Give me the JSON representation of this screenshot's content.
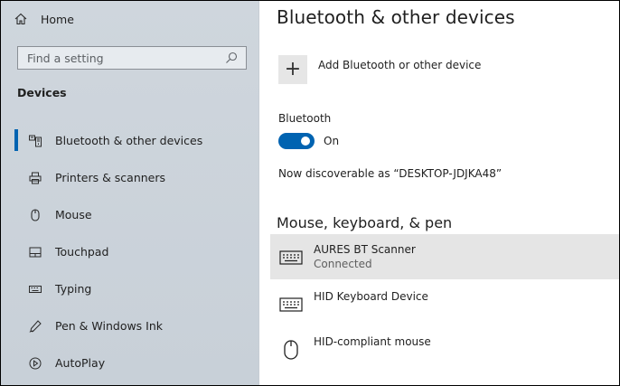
{
  "sidebar": {
    "home_label": "Home",
    "search_placeholder": "Find a setting",
    "section_title": "Devices",
    "items": [
      {
        "label": "Bluetooth & other devices",
        "icon": "bluetooth-devices-icon",
        "active": true
      },
      {
        "label": "Printers & scanners",
        "icon": "printer-icon"
      },
      {
        "label": "Mouse",
        "icon": "mouse-icon"
      },
      {
        "label": "Touchpad",
        "icon": "touchpad-icon"
      },
      {
        "label": "Typing",
        "icon": "keyboard-icon"
      },
      {
        "label": "Pen & Windows Ink",
        "icon": "pen-icon"
      },
      {
        "label": "AutoPlay",
        "icon": "autoplay-icon"
      }
    ]
  },
  "main": {
    "title": "Bluetooth & other devices",
    "add_device_label": "Add Bluetooth or other device",
    "bluetooth_label": "Bluetooth",
    "bluetooth_state": "On",
    "discoverable_text": "Now discoverable as “DESKTOP-JDJKA48”",
    "section_title": "Mouse, keyboard, & pen",
    "devices": [
      {
        "name": "AURES BT Scanner",
        "status": "Connected",
        "icon": "keyboard-icon"
      },
      {
        "name": "HID Keyboard Device",
        "status": "",
        "icon": "keyboard-icon"
      },
      {
        "name": "HID-compliant mouse",
        "status": "",
        "icon": "mouse-icon"
      }
    ]
  },
  "colors": {
    "accent": "#0063b1",
    "sidebar_bg": "#cfd6dd",
    "selected_bg": "#e5e5e5"
  }
}
